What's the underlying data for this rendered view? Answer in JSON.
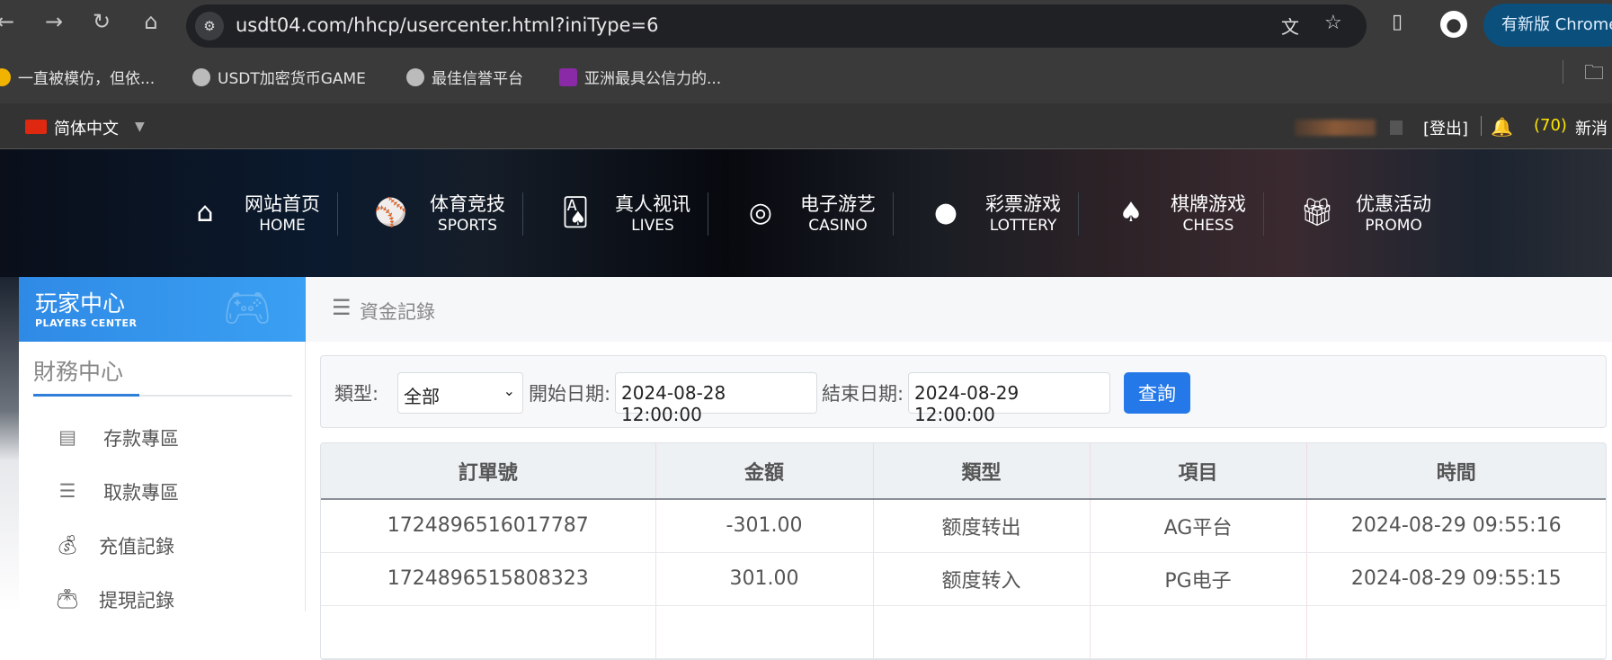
{
  "browser": {
    "url": "usdt04.com/hhcp/usercenter.html?iniType=6",
    "update_label": "有新版 Chrome",
    "bookmarks": [
      {
        "label": "一直被模仿，但依..."
      },
      {
        "label": "USDT加密货币GAME"
      },
      {
        "label": "最佳信誉平台"
      },
      {
        "label": "亚洲最具公信力的..."
      }
    ]
  },
  "topbar": {
    "language": "简体中文",
    "logout": "[登出]",
    "message_count": "(70)",
    "messages_label": "新消",
    "colors": {
      "count": "#ffe600"
    }
  },
  "nav": [
    {
      "zh": "网站首页",
      "en": "HOME",
      "icon": "home-icon"
    },
    {
      "zh": "体育竞技",
      "en": "SPORTS",
      "icon": "ball-icon"
    },
    {
      "zh": "真人视讯",
      "en": "LIVES",
      "icon": "cards-icon"
    },
    {
      "zh": "电子游艺",
      "en": "CASINO",
      "icon": "slot-icon"
    },
    {
      "zh": "彩票游戏",
      "en": "LOTTERY",
      "icon": "lottery-balls-icon"
    },
    {
      "zh": "棋牌游戏",
      "en": "CHESS",
      "icon": "spade-icon"
    },
    {
      "zh": "优惠活动",
      "en": "PROMO",
      "icon": "gift-icon"
    }
  ],
  "sidebar": {
    "title": "玩家中心",
    "subtitle": "PLAYERS CENTER",
    "section": "財務中心",
    "items": [
      {
        "label": "存款專區",
        "icon": "card-icon"
      },
      {
        "label": "取款專區",
        "icon": "hand-money-icon"
      },
      {
        "label": "充值記錄",
        "icon": "money-bag-icon"
      },
      {
        "label": "提現記錄",
        "icon": "wallet-icon"
      }
    ]
  },
  "main": {
    "title": "資金記錄",
    "filter": {
      "type_label": "類型:",
      "type_value": "全部",
      "start_label": "開始日期:",
      "start_value": "2024-08-28 12:00:00",
      "end_label": "結束日期:",
      "end_value": "2024-08-29 12:00:00",
      "query_label": "查詢"
    },
    "table": {
      "headers": [
        "訂單號",
        "金額",
        "類型",
        "項目",
        "時間"
      ],
      "rows": [
        [
          "1724896516017787",
          "-301.00",
          "额度转出",
          "AG平台",
          "2024-08-29 09:55:16"
        ],
        [
          "1724896515808323",
          "301.00",
          "额度转入",
          "PG电子",
          "2024-08-29 09:55:15"
        ]
      ]
    }
  },
  "colors": {
    "accent": "#2478e8",
    "sidebar_header": "#2f8ae6"
  }
}
